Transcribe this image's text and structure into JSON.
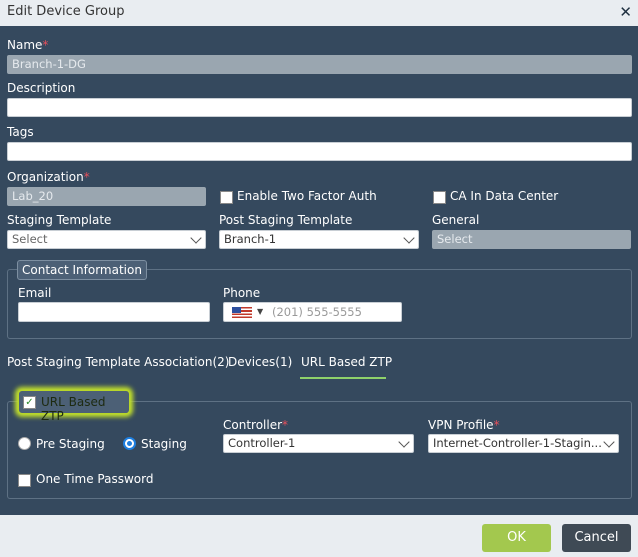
{
  "dialog": {
    "title": "Edit Device Group"
  },
  "name": {
    "label": "Name",
    "required_mark": "*",
    "value": "Branch-1-DG"
  },
  "description": {
    "label": "Description",
    "value": ""
  },
  "tags": {
    "label": "Tags",
    "value": ""
  },
  "organization": {
    "label": "Organization",
    "required_mark": "*",
    "value": "Lab_20"
  },
  "two_factor": {
    "label": "Enable Two Factor Auth",
    "checked": false
  },
  "ca_in_dc": {
    "label": "CA In Data Center",
    "checked": false
  },
  "staging_template": {
    "label": "Staging Template",
    "value": "Select"
  },
  "post_staging_template": {
    "label": "Post Staging Template",
    "value": "Branch-1"
  },
  "general": {
    "label": "General",
    "value": "Select"
  },
  "contact": {
    "legend": "Contact Information",
    "email_label": "Email",
    "email_value": "",
    "phone_label": "Phone",
    "phone_placeholder": "(201) 555-5555"
  },
  "tabs": [
    {
      "label": "Post Staging Template Association(2)",
      "active": false
    },
    {
      "label": "Devices(1)",
      "active": false
    },
    {
      "label": "URL Based ZTP",
      "active": true
    }
  ],
  "ztp": {
    "checkbox_label": "URL Based ZTP",
    "checked": true,
    "highlight_color": "#c8e62a",
    "radio_pre": "Pre Staging",
    "radio_staging": "Staging",
    "selected_mode": "Staging",
    "controller_label": "Controller",
    "controller_required": "*",
    "controller_value": "Controller-1",
    "vpn_label": "VPN Profile",
    "vpn_required": "*",
    "vpn_value": "Internet-Controller-1-Stagin...",
    "otp_label": "One Time Password",
    "otp_checked": false
  },
  "footer": {
    "ok_label": "OK",
    "cancel_label": "Cancel",
    "ok_color": "#a3c84e",
    "cancel_color": "#3f4a55"
  },
  "icons": [
    "close-icon",
    "chevron-down-icon",
    "us-flag-icon",
    "checkmark-icon"
  ]
}
